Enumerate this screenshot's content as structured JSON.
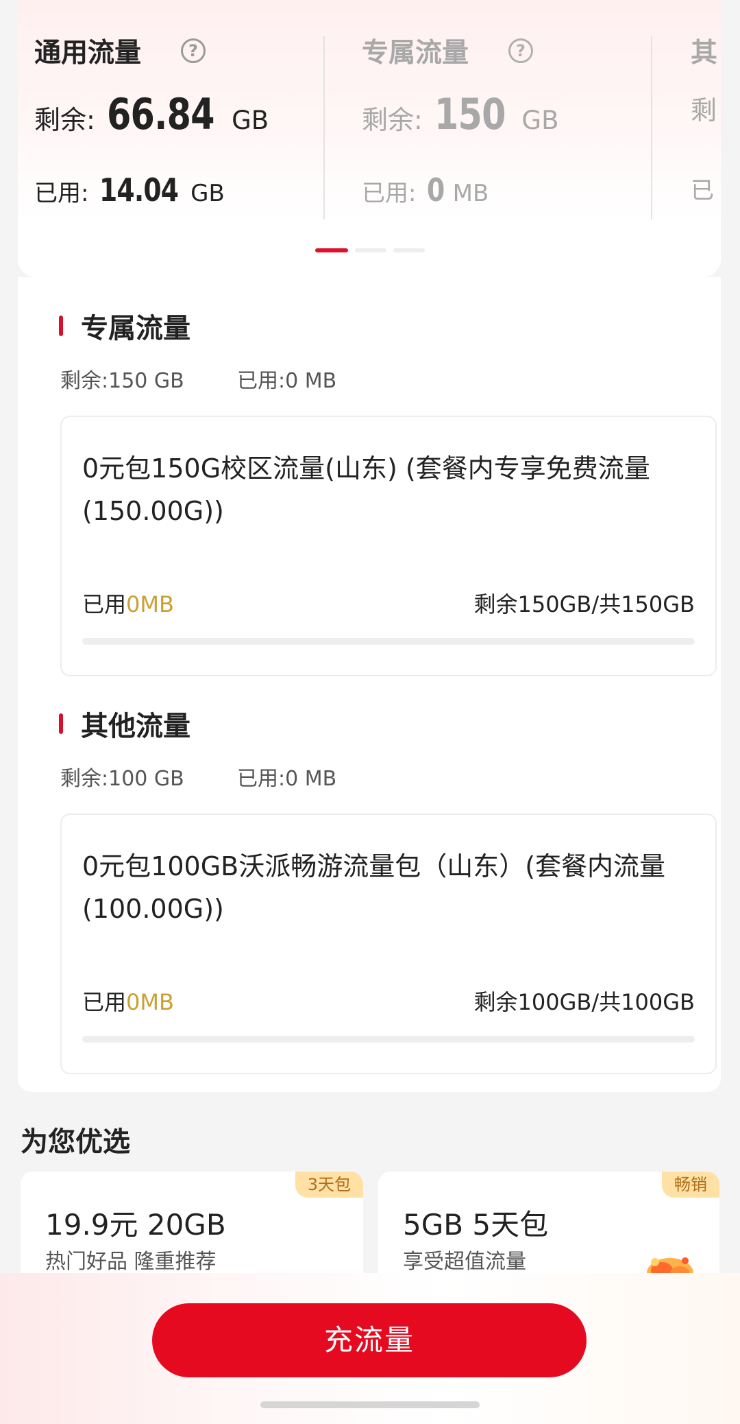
{
  "summary": {
    "cards": [
      {
        "title": "通用流量",
        "remain_label": "剩余:",
        "remain_value": "66.84",
        "remain_unit": "GB",
        "used_label": "已用:",
        "used_value": "14.04",
        "used_unit": "GB"
      },
      {
        "title": "专属流量",
        "remain_label": "剩余:",
        "remain_value": "150",
        "remain_unit": "GB",
        "used_label": "已用:",
        "used_value": "0",
        "used_unit": "MB"
      },
      {
        "title": "其",
        "remain_label": "剩",
        "used_label": "已"
      }
    ],
    "help_glyph": "?",
    "pager_active_index": 0,
    "pager_count": 3
  },
  "sections": [
    {
      "title": "专属流量",
      "remain": "剩余:150 GB",
      "used": "已用:0 MB",
      "package": {
        "name": "0元包150G校区流量(山东) (套餐内专享免费流量(150.00G))",
        "used_label": "已用",
        "used_value": "0MB",
        "left_text": "剩余150GB/共150GB",
        "used_fraction": 0
      }
    },
    {
      "title": "其他流量",
      "remain": "剩余:100 GB",
      "used": "已用:0 MB",
      "package": {
        "name": "0元包100GB沃派畅游流量包（山东）(套餐内流量(100.00G))",
        "used_label": "已用",
        "used_value": "0MB",
        "left_text": "剩余100GB/共100GB",
        "used_fraction": 0
      }
    }
  ],
  "recommend": {
    "title": "为您优选",
    "items": [
      {
        "badge": "3天包",
        "title": "19.9元 20GB",
        "subtitle": "热门好品 隆重推荐"
      },
      {
        "badge": "畅销",
        "title": "5GB 5天包",
        "subtitle": "享受超值流量",
        "icon": "gift-box-icon"
      }
    ]
  },
  "action": {
    "button_label": "充流量"
  },
  "colors": {
    "brand_red": "#e60a20",
    "accent_gold": "#c9a033",
    "badge_bg": "#ffe1a6"
  }
}
